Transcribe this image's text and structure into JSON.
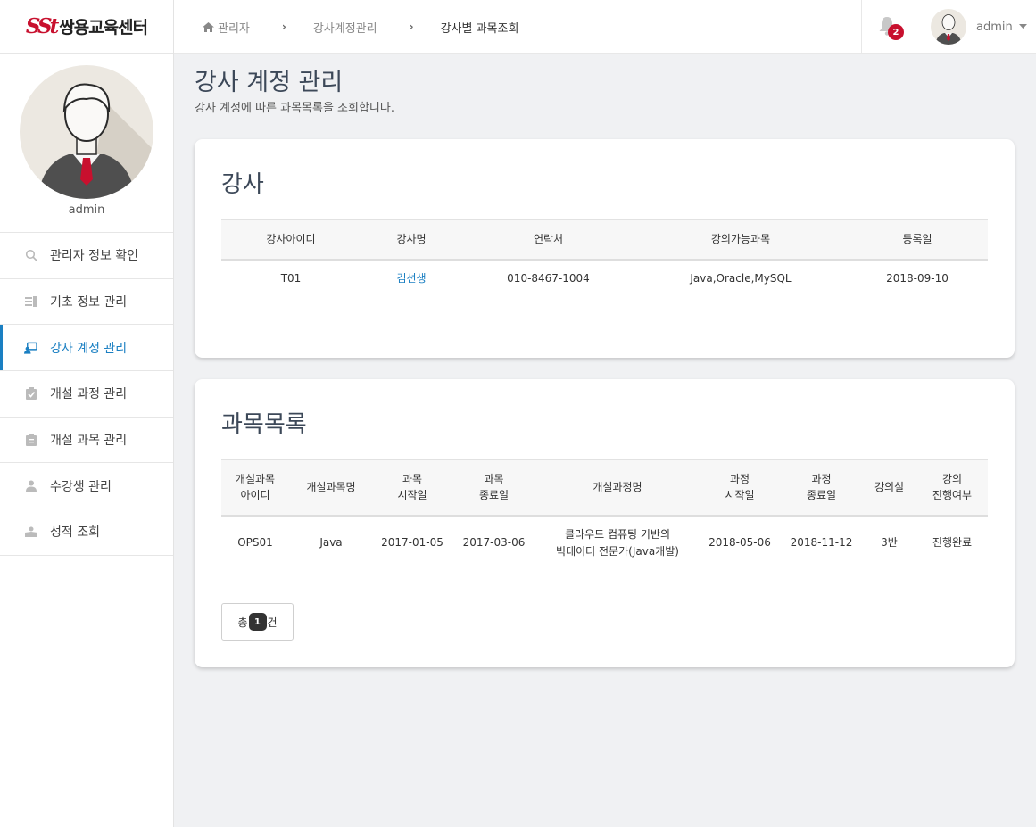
{
  "sidebar": {
    "logo_mark": "SSt",
    "logo_text": "쌍용교육센터",
    "profile_name": "admin",
    "items": [
      {
        "label": "관리자 정보 확인",
        "icon": "search-icon"
      },
      {
        "label": "기초 정보 관리",
        "icon": "list-icon"
      },
      {
        "label": "강사 계정 관리",
        "icon": "teacher-icon",
        "active": true
      },
      {
        "label": "개설 과정 관리",
        "icon": "clipboard-check-icon"
      },
      {
        "label": "개설 과목 관리",
        "icon": "clipboard-icon"
      },
      {
        "label": "수강생 관리",
        "icon": "user-icon"
      },
      {
        "label": "성적 조회",
        "icon": "grade-icon"
      }
    ]
  },
  "topbar": {
    "breadcrumb": [
      "관리자",
      "강사계정관리",
      "강사별 과목조회"
    ],
    "notification_count": "2",
    "user_name": "admin"
  },
  "page": {
    "title": "강사 계정 관리",
    "subtitle": "강사 계정에 따른 과목목록을 조회합니다."
  },
  "teacher_card": {
    "title": "강사",
    "headers": [
      "강사아이디",
      "강사명",
      "연락처",
      "강의가능과목",
      "등록일"
    ],
    "rows": [
      [
        "T01",
        "김선생",
        "010-8467-1004",
        "Java,Oracle,MySQL",
        "2018-09-10"
      ]
    ]
  },
  "subject_card": {
    "title": "과목목록",
    "headers": [
      [
        "개설과목",
        "아이디"
      ],
      [
        "개설과목명"
      ],
      [
        "과목",
        "시작일"
      ],
      [
        "과목",
        "종료일"
      ],
      [
        "개설과정명"
      ],
      [
        "과정",
        "시작일"
      ],
      [
        "과정",
        "종료일"
      ],
      [
        "강의실"
      ],
      [
        "강의",
        "진행여부"
      ]
    ],
    "rows": [
      {
        "id": "OPS01",
        "name": "Java",
        "subject_start": "2017-01-05",
        "subject_end": "2017-03-06",
        "course_name": [
          "클라우드 컴퓨팅 기반의",
          "빅데이터 전문가(Java개발)"
        ],
        "course_start": "2018-05-06",
        "course_end": "2018-11-12",
        "room": "3반",
        "status": "진행완료"
      }
    ],
    "pager": {
      "prefix": "총",
      "count": "1",
      "suffix": "건"
    }
  },
  "colors": {
    "accent": "#1a7fc2",
    "brand": "#c8102e",
    "badge": "#c8102e",
    "background": "#f0f1f3"
  }
}
